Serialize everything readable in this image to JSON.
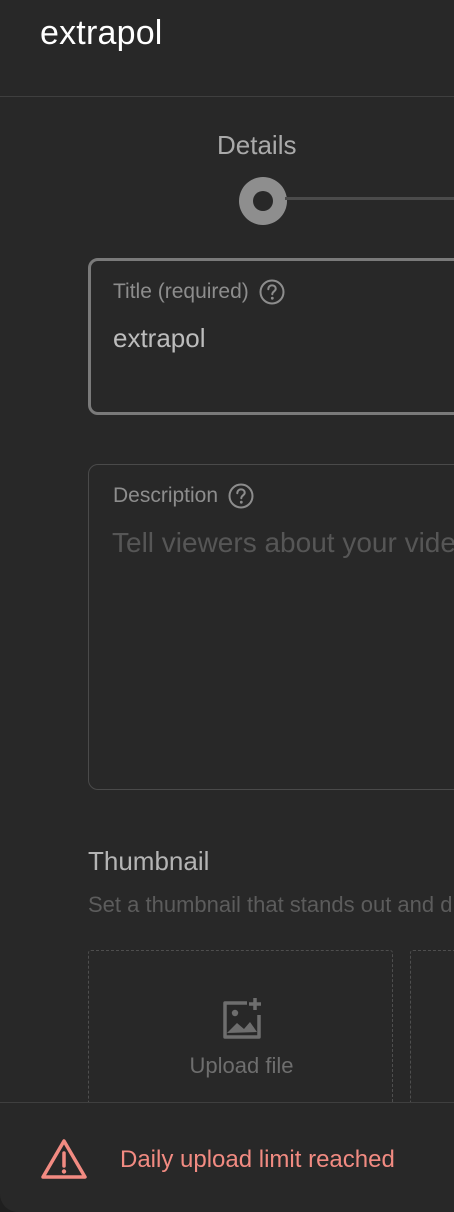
{
  "header": {
    "title": "extrapol"
  },
  "stepper": {
    "current_step": "Details"
  },
  "title_field": {
    "label": "Title (required)",
    "value": "extrapol",
    "help_icon": "help-circle-icon"
  },
  "description_field": {
    "label": "Description",
    "placeholder": "Tell viewers about your video",
    "help_icon": "help-circle-icon"
  },
  "thumbnail": {
    "heading": "Thumbnail",
    "subtitle": "Set a thumbnail that stands out and draws viewers' attention",
    "upload_label": "Upload file",
    "upload_icon": "add-photo-icon"
  },
  "footer": {
    "warning_text": "Daily upload limit reached",
    "warning_icon": "warning-triangle-icon",
    "warning_color": "#f28b82"
  },
  "colors": {
    "background": "#282828",
    "title_text": "#ffffff",
    "warning": "#f28b82"
  }
}
